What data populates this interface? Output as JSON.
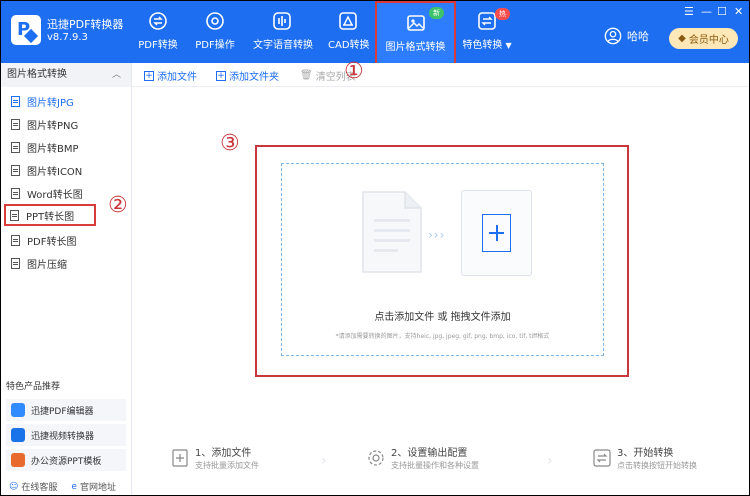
{
  "app": {
    "name": "迅捷PDF转换器",
    "version": "v8.7.9.3",
    "user": "哈哈",
    "vip_label": "会员中心"
  },
  "nav": [
    {
      "label": "PDF转换",
      "icon": "pdf-convert-icon"
    },
    {
      "label": "PDF操作",
      "icon": "pdf-operate-icon"
    },
    {
      "label": "文字语音转换",
      "icon": "audio-wave-icon"
    },
    {
      "label": "CAD转换",
      "icon": "cad-icon"
    },
    {
      "label": "图片格式转换",
      "icon": "image-icon",
      "badge": "新",
      "active": true
    },
    {
      "label": "特色转换",
      "icon": "feature-convert-icon",
      "badge": "热",
      "dropdown": true
    }
  ],
  "sidebar": {
    "header": "图片格式转换",
    "items": [
      {
        "label": "图片转JPG",
        "active": true
      },
      {
        "label": "图片转PNG"
      },
      {
        "label": "图片转BMP"
      },
      {
        "label": "图片转ICON"
      },
      {
        "label": "Word转长图"
      },
      {
        "label": "PPT转长图"
      },
      {
        "label": "PDF转长图"
      },
      {
        "label": "图片压缩"
      }
    ],
    "promo_title": "特色产品推荐",
    "promo": [
      {
        "label": "迅捷PDF编辑器",
        "color": "#2f8bff"
      },
      {
        "label": "迅捷视频转换器",
        "color": "#1a73e8"
      },
      {
        "label": "办公资源PPT模板",
        "color": "#e86a2c"
      }
    ],
    "footer": {
      "service": "在线客服",
      "site": "官网地址"
    }
  },
  "toolbar": {
    "add_file": "添加文件",
    "add_folder": "添加文件夹",
    "clear_list": "清空列表"
  },
  "drop": {
    "main": "点击添加文件 或 拖拽文件添加",
    "hint": "*请添加需要转换的图片，支持heic, jpg, jpeg, gif, png, bmp, ico, tif, tiff格式"
  },
  "steps": [
    {
      "title": "1、添加文件",
      "desc": "支持批量添加文件"
    },
    {
      "title": "2、设置输出配置",
      "desc": "支持批量操作和各种设置"
    },
    {
      "title": "3、开始转换",
      "desc": "点击转换按钮开始转换"
    }
  ],
  "annotations": [
    "①",
    "②",
    "③"
  ],
  "colors": {
    "brand": "#1d6ef0",
    "annotation": "#c9353a"
  }
}
